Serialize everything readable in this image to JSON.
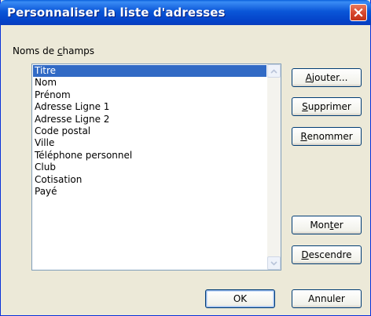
{
  "window": {
    "title": "Personnaliser la liste d'adresses"
  },
  "group": {
    "label_pre": "Noms de ",
    "label_accel": "c",
    "label_post": "hamps"
  },
  "fields": [
    {
      "label": "Titre",
      "selected": true
    },
    {
      "label": "Nom",
      "selected": false
    },
    {
      "label": "Prénom",
      "selected": false
    },
    {
      "label": "Adresse Ligne 1",
      "selected": false
    },
    {
      "label": "Adresse Ligne 2",
      "selected": false
    },
    {
      "label": "Code postal",
      "selected": false
    },
    {
      "label": "Ville",
      "selected": false
    },
    {
      "label": "Téléphone personnel",
      "selected": false
    },
    {
      "label": "Club",
      "selected": false
    },
    {
      "label": "Cotisation",
      "selected": false
    },
    {
      "label": "Payé",
      "selected": false
    }
  ],
  "buttons": {
    "add": {
      "pre": "",
      "accel": "A",
      "post": "jouter..."
    },
    "delete": {
      "pre": "",
      "accel": "S",
      "post": "upprimer"
    },
    "rename": {
      "pre": "",
      "accel": "R",
      "post": "enommer"
    },
    "up": {
      "pre": "Mon",
      "accel": "t",
      "post": "er"
    },
    "down": {
      "pre": "",
      "accel": "D",
      "post": "escendre"
    },
    "ok": "OK",
    "cancel": "Annuler"
  },
  "colors": {
    "titlebar": "#0a56d8",
    "selection": "#316ac5",
    "dialog_bg": "#ece9d8",
    "close_button": "#d6452b"
  },
  "icons": {
    "close": "close-icon",
    "scroll_up": "chevron-up-icon",
    "scroll_down": "chevron-down-icon"
  }
}
